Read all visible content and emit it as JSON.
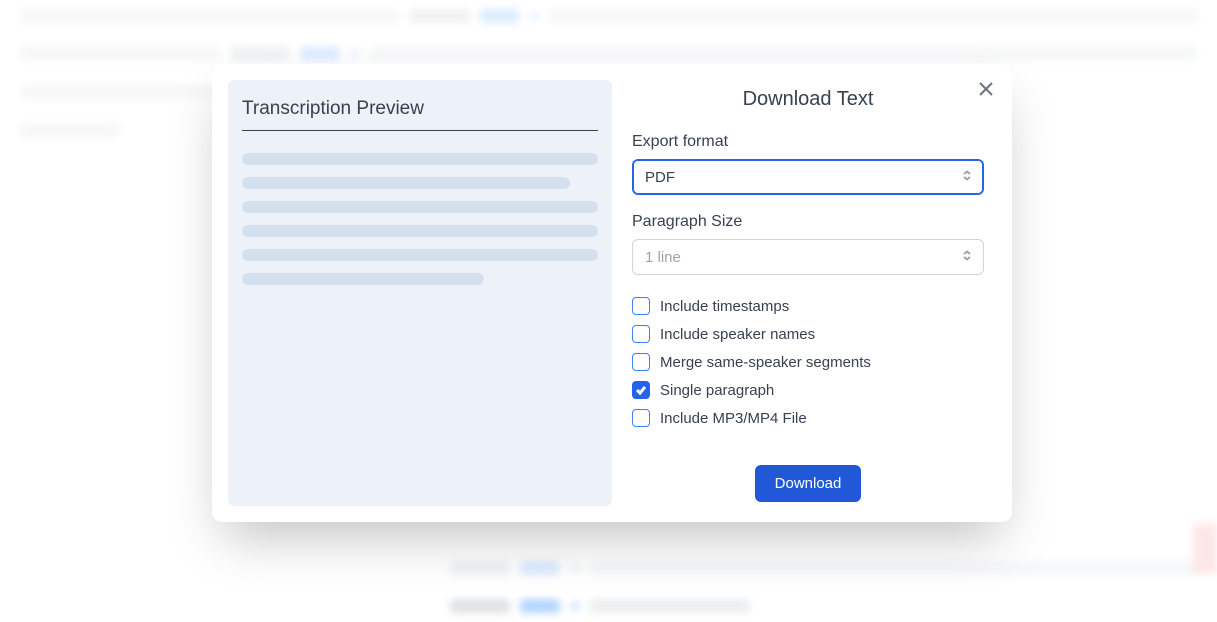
{
  "modal": {
    "preview_title": "Transcription Preview",
    "title": "Download Text",
    "export_format_label": "Export format",
    "export_format_value": "PDF",
    "paragraph_size_label": "Paragraph Size",
    "paragraph_size_value": "1 line",
    "options": [
      {
        "key": "include_timestamps",
        "label": "Include timestamps",
        "checked": false
      },
      {
        "key": "include_speaker_names",
        "label": "Include speaker names",
        "checked": false
      },
      {
        "key": "merge_same_speaker",
        "label": "Merge same-speaker segments",
        "checked": false
      },
      {
        "key": "single_paragraph",
        "label": "Single paragraph",
        "checked": true
      },
      {
        "key": "include_mp3_mp4",
        "label": "Include MP3/MP4 File",
        "checked": false
      }
    ],
    "download_button": "Download"
  }
}
